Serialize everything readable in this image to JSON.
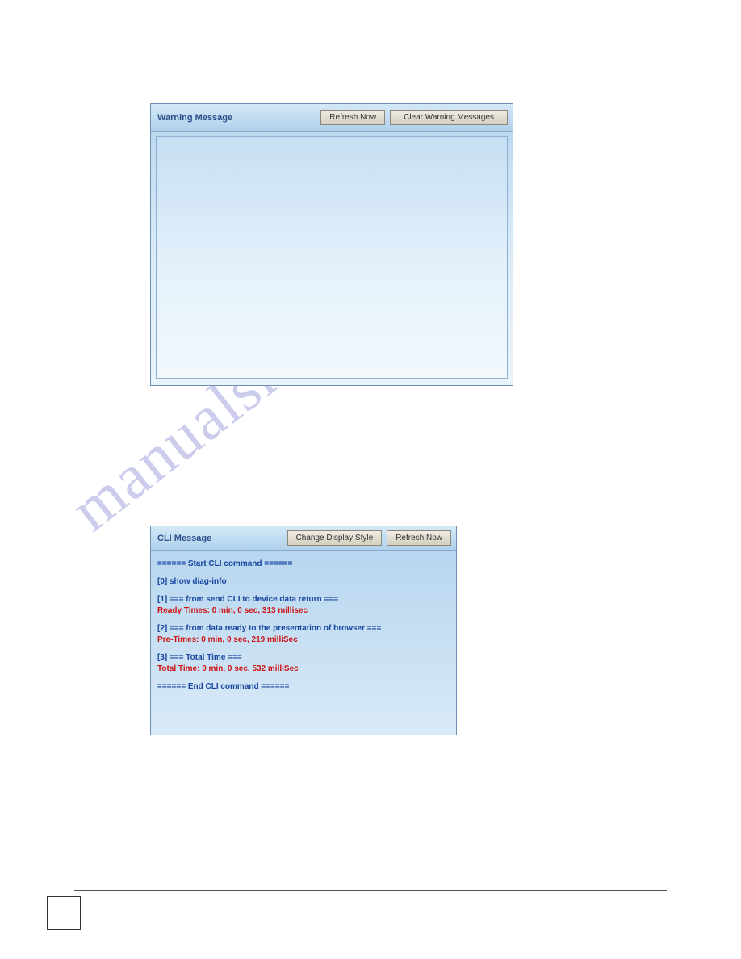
{
  "watermark": "manualshive.com",
  "panel1": {
    "title": "Warning Message",
    "btn_refresh": "Refresh Now",
    "btn_clear": "Clear Warning Messages"
  },
  "panel2": {
    "title": "CLI Message",
    "btn_style": "Change Display Style",
    "btn_refresh": "Refresh Now",
    "lines": {
      "start": "====== Start CLI command ======",
      "l0": "[0] show diag-info",
      "l1": "[1] === from send CLI to device data return ===",
      "l1t": "Ready Times: 0 min, 0 sec, 313 millisec",
      "l2": "[2] === from data ready to the presentation of browser ===",
      "l2t": "Pre-Times: 0 min, 0 sec, 219 milliSec",
      "l3": "[3] === Total Time ===",
      "l3t": "Total Time: 0 min, 0 sec, 532 milliSec",
      "end": "====== End CLI command ======"
    }
  }
}
